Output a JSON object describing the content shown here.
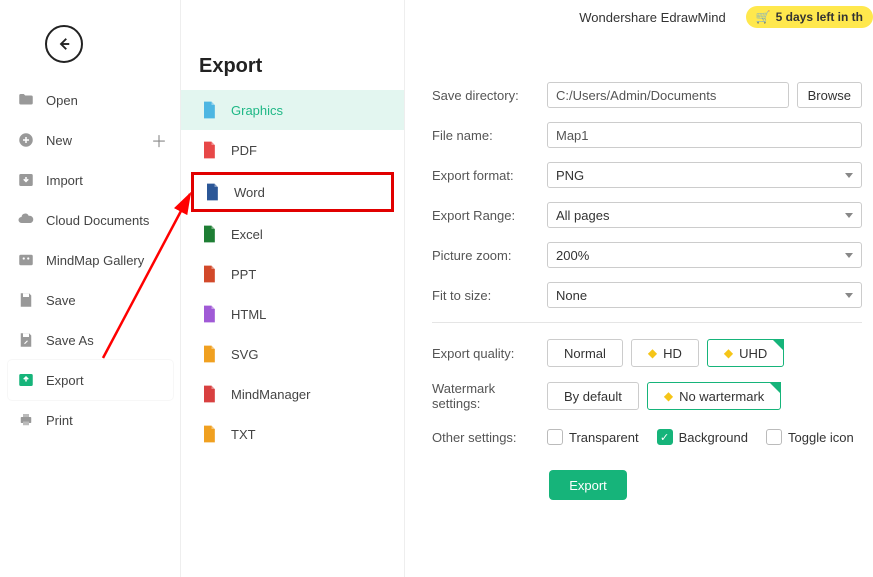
{
  "topbar": {
    "app_title": "Wondershare EdrawMind",
    "trial_text": "5 days left in th"
  },
  "sidebar": {
    "items": [
      {
        "label": "Open",
        "icon": "folder"
      },
      {
        "label": "New",
        "icon": "plus-circle",
        "has_plus": true
      },
      {
        "label": "Import",
        "icon": "import"
      },
      {
        "label": "Cloud Documents",
        "icon": "cloud"
      },
      {
        "label": "MindMap Gallery",
        "icon": "gallery"
      },
      {
        "label": "Save",
        "icon": "save"
      },
      {
        "label": "Save As",
        "icon": "save-as"
      },
      {
        "label": "Export",
        "icon": "export",
        "active": true
      },
      {
        "label": "Print",
        "icon": "print"
      }
    ]
  },
  "mid": {
    "title": "Export",
    "formats": [
      {
        "label": "Graphics",
        "color": "#4db6e2",
        "selected": true
      },
      {
        "label": "PDF",
        "color": "#e74848"
      },
      {
        "label": "Word",
        "color": "#2b5797",
        "highlighted": true
      },
      {
        "label": "Excel",
        "color": "#1e7e34"
      },
      {
        "label": "PPT",
        "color": "#d2492a"
      },
      {
        "label": "HTML",
        "color": "#a05ad6"
      },
      {
        "label": "SVG",
        "color": "#f0a020"
      },
      {
        "label": "MindManager",
        "color": "#d84040"
      },
      {
        "label": "TXT",
        "color": "#f0a020"
      }
    ]
  },
  "form": {
    "save_dir_label": "Save directory:",
    "save_dir_value": "C:/Users/Admin/Documents",
    "browse": "Browse",
    "file_name_label": "File name:",
    "file_name_value": "Map1",
    "format_label": "Export format:",
    "format_value": "PNG",
    "range_label": "Export Range:",
    "range_value": "All pages",
    "zoom_label": "Picture zoom:",
    "zoom_value": "200%",
    "fit_label": "Fit to size:",
    "fit_value": "None",
    "quality_label": "Export quality:",
    "quality_opts": [
      "Normal",
      "HD",
      "UHD"
    ],
    "wm_label": "Watermark settings:",
    "wm_opts": [
      "By default",
      "No wartermark"
    ],
    "other_label": "Other settings:",
    "chk_transparent": "Transparent",
    "chk_background": "Background",
    "chk_toggle": "Toggle icon",
    "export_btn": "Export"
  }
}
